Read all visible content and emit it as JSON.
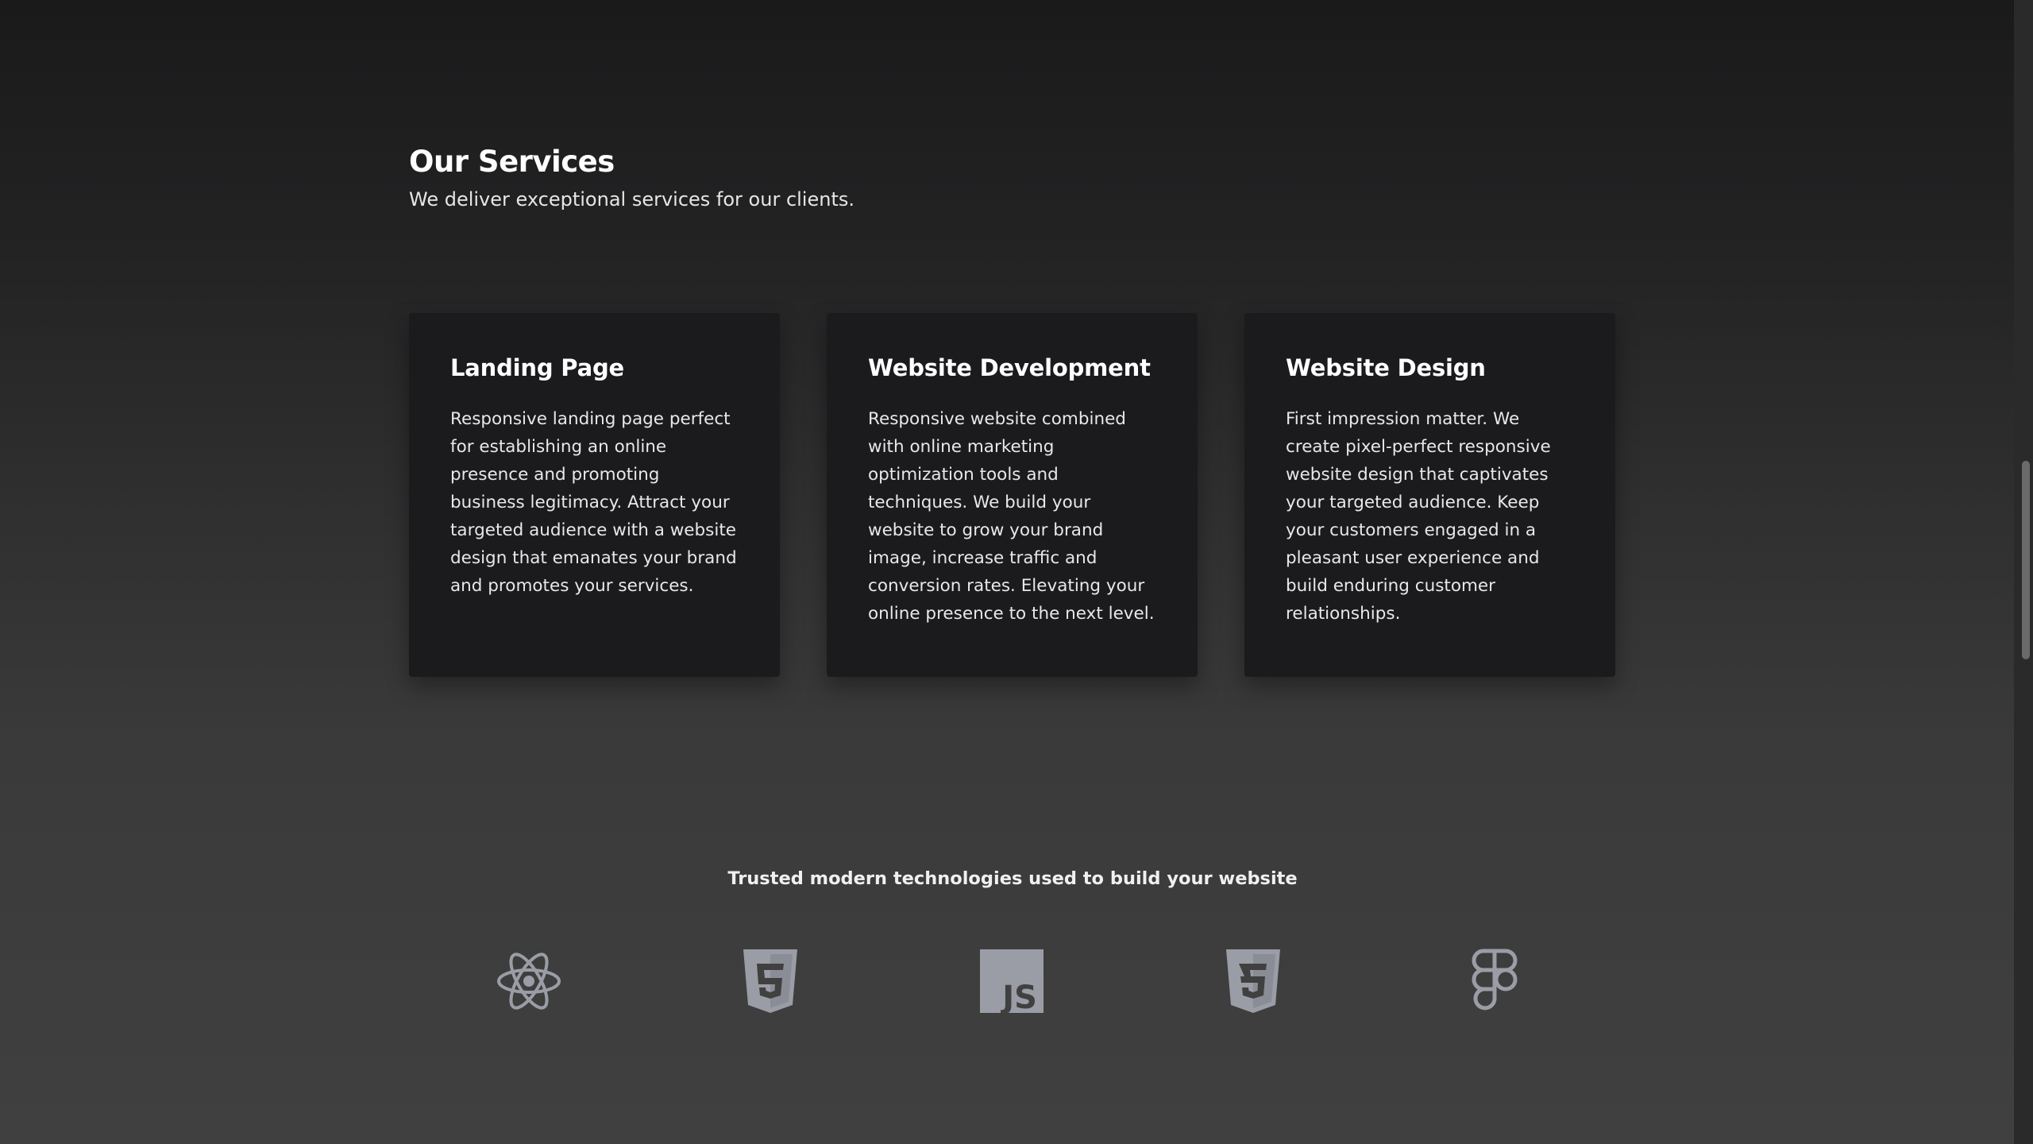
{
  "services": {
    "title": "Our Services",
    "subtitle": "We deliver exceptional services for our clients.",
    "cards": [
      {
        "title": "Landing Page",
        "text": "Responsive landing page perfect for establishing an online presence and promoting business legitimacy. Attract your targeted audience with a website design that emanates your brand and promotes your services."
      },
      {
        "title": "Website Development",
        "text": "Responsive website combined with online marketing optimization tools and techniques. We build your website to grow your brand image, increase traffic and conversion rates. Elevating your online presence to the next level."
      },
      {
        "title": "Website Design",
        "text": "First impression matter. We create pixel-perfect responsive website design that captivates your targeted audience. Keep your customers engaged in a pleasant user experience and build enduring customer relationships."
      }
    ]
  },
  "technologies": {
    "heading": "Trusted modern technologies used to build your website",
    "icons": [
      "react-icon",
      "html5-icon",
      "javascript-icon",
      "css3-icon",
      "figma-icon"
    ],
    "icon_color": "#9a9da6",
    "js_label": "JS"
  },
  "colors": {
    "card_background": "#1b1b1d",
    "text": "#ffffff"
  }
}
